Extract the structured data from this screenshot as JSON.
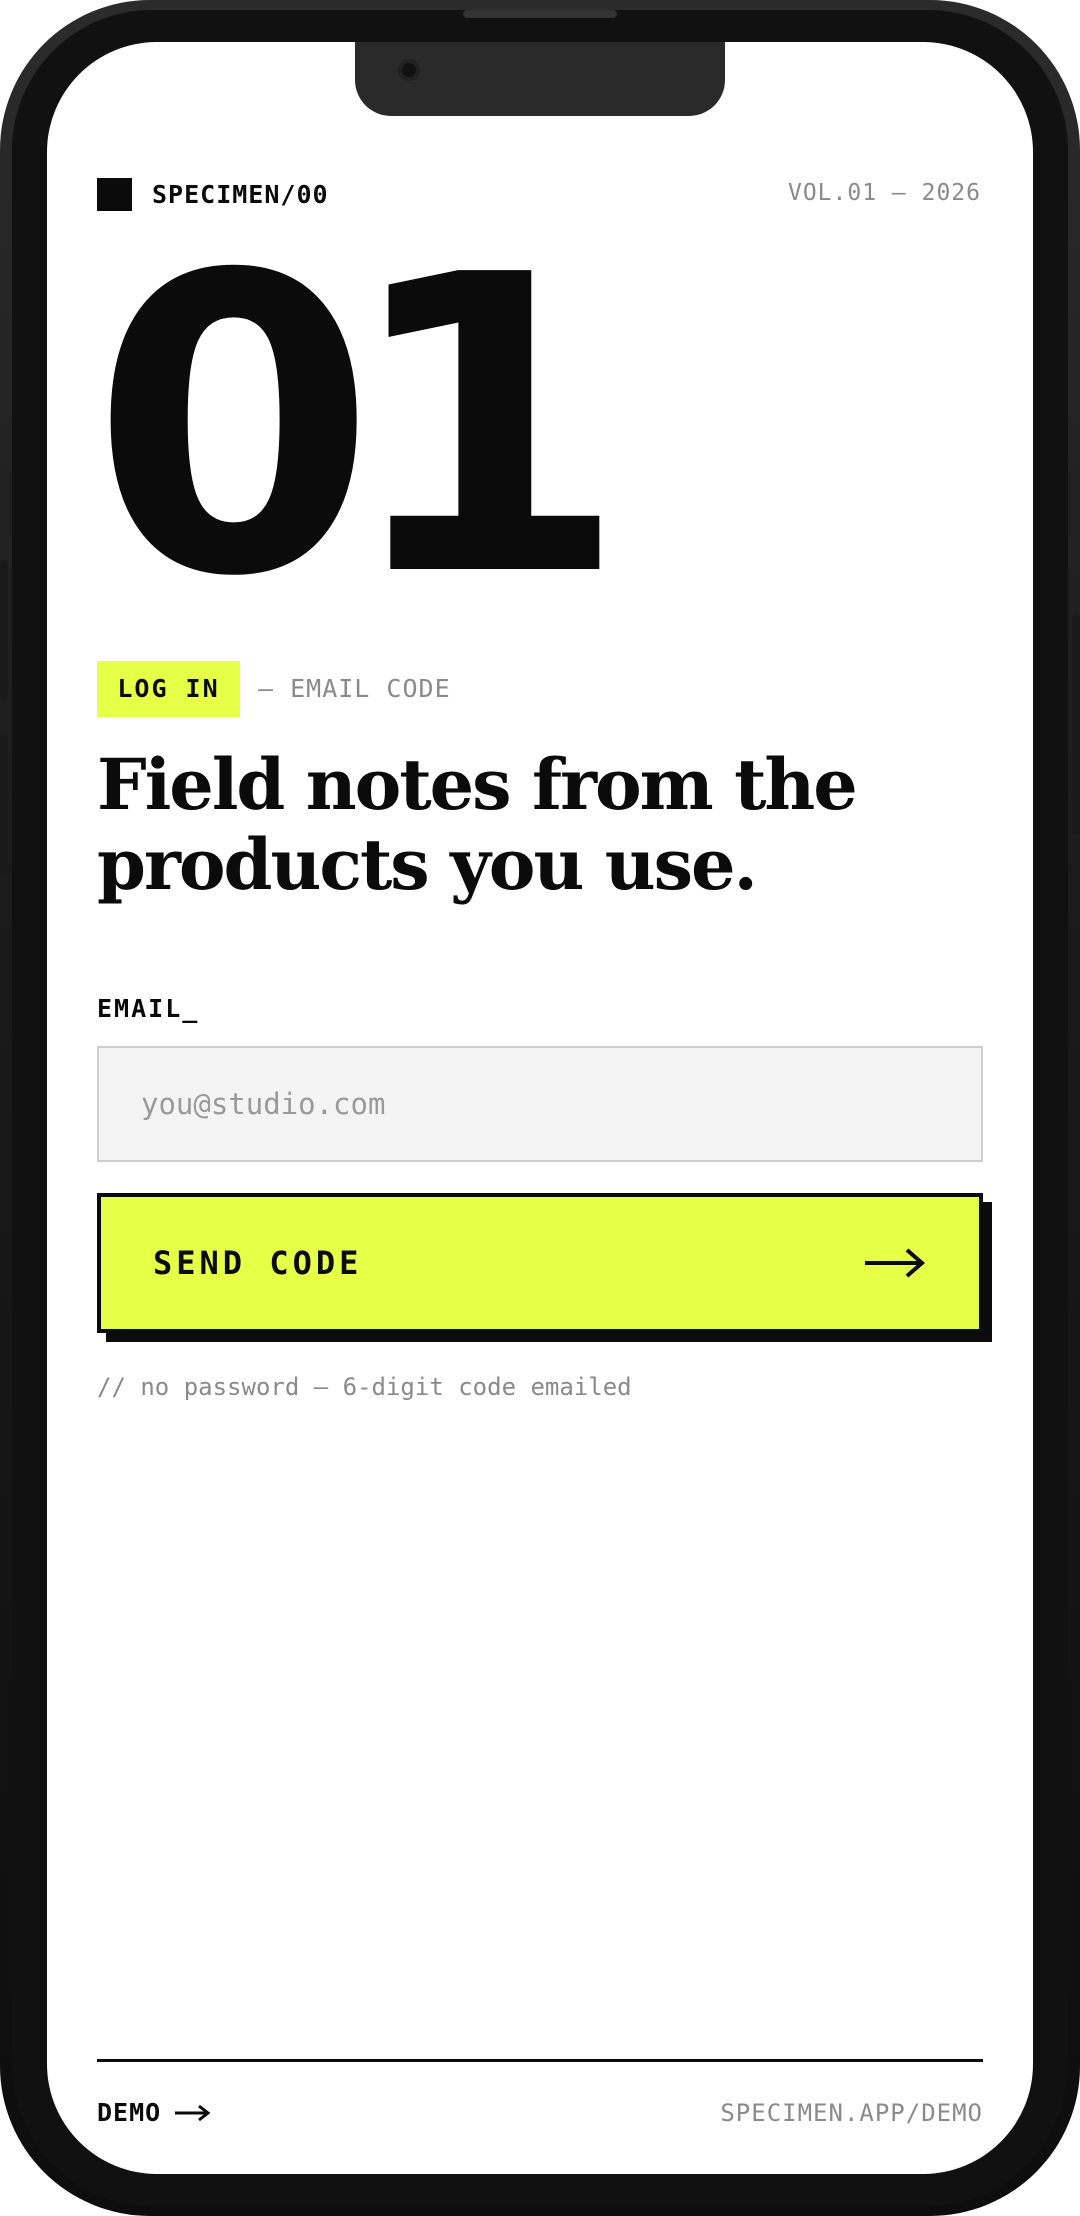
{
  "header": {
    "brand": "SPECIMEN/00",
    "volume": "VOL.01 — 2026",
    "logo_icon": "square-logo-icon"
  },
  "hero": {
    "number": "01"
  },
  "tag": {
    "label": "LOG IN",
    "sub": "— EMAIL CODE"
  },
  "headline": "Field notes from the products you use.",
  "form": {
    "email_label": "EMAIL_",
    "email_placeholder": "you@studio.com",
    "email_value": "",
    "submit_label": "SEND CODE",
    "submit_icon": "arrow-right-icon",
    "hint": "// no password — 6-digit code emailed"
  },
  "footer": {
    "demo_label": "DEMO",
    "demo_icon": "arrow-right-icon",
    "url": "SPECIMEN.APP/DEMO"
  },
  "colors": {
    "accent": "#e6ff47",
    "ink": "#0b0b0b",
    "muted": "#8a8a8a",
    "input_bg": "#f4f4f4"
  }
}
